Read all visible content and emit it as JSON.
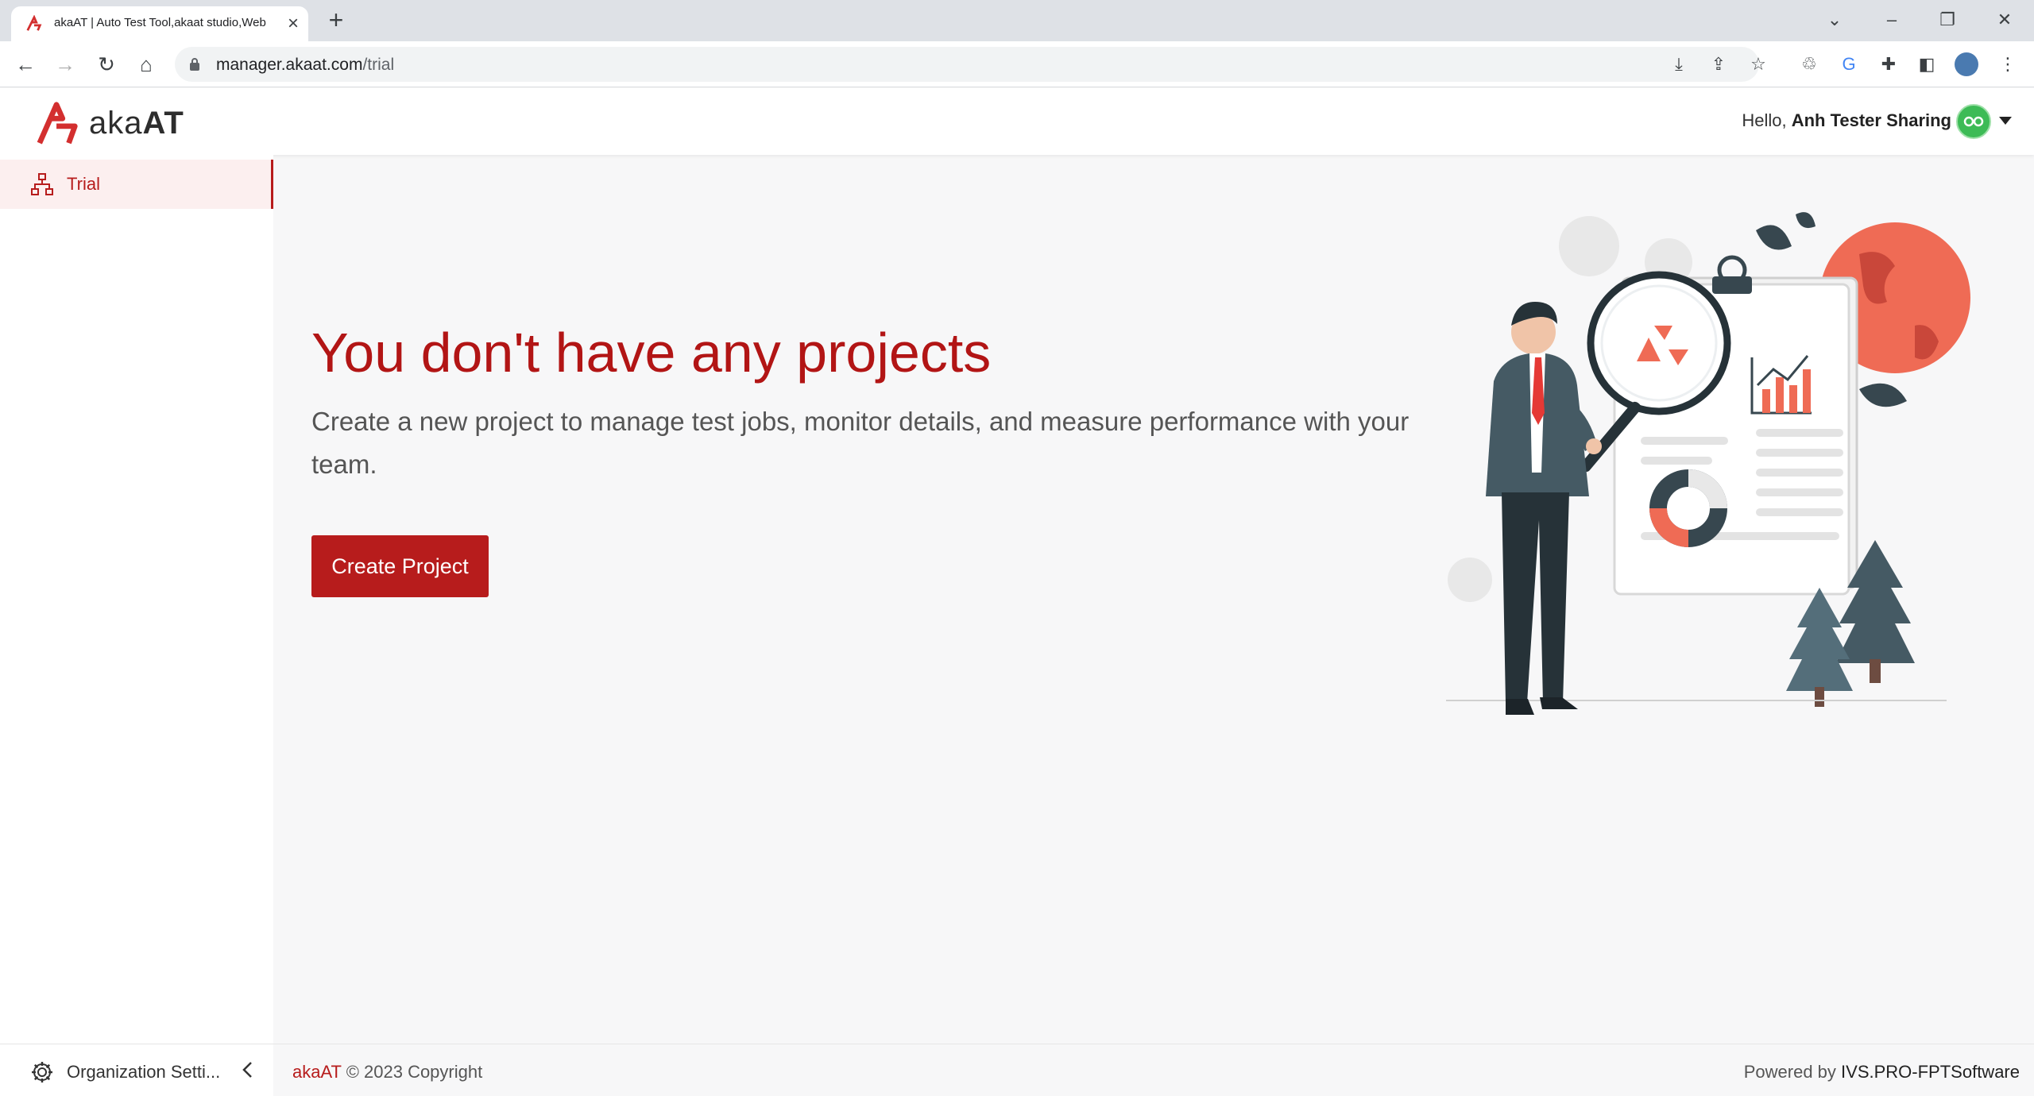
{
  "browser": {
    "tab_title": "akaAT | Auto Test Tool,akaat studio,Web",
    "url_host": "manager.akaat.com",
    "url_path": "/trial"
  },
  "header": {
    "logo_text_aka": "aka",
    "logo_text_at": "AT",
    "greeting_prefix": "Hello,",
    "user_name": "Anh Tester Sharing"
  },
  "sidebar": {
    "items": [
      {
        "label": "Trial",
        "icon": "sitemap-icon",
        "active": true
      }
    ]
  },
  "main": {
    "title": "You don't have any projects",
    "description": "Create a new project to manage test jobs, monitor details, and measure performance with your team.",
    "create_button": "Create Project"
  },
  "footer": {
    "org_settings": "Organization Setti...",
    "brand": "akaAT",
    "copyright": "© 2023 Copyright",
    "powered_prefix": "Powered by",
    "powered_org": "IVS.PRO-FPTSoftware"
  },
  "colors": {
    "brand_red": "#b71c1c",
    "title_red": "#b21515",
    "avatar_green": "#3dbb56"
  }
}
